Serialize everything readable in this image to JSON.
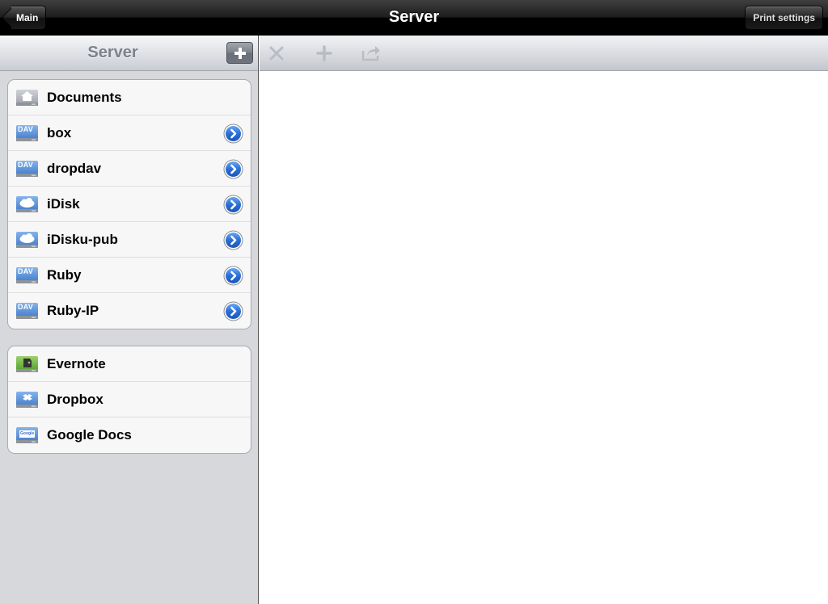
{
  "navbar": {
    "back_label": "Main",
    "title": "Server",
    "print_label": "Print settings"
  },
  "sidebar": {
    "title": "Server",
    "add_icon": "plus-icon",
    "groups": [
      {
        "items": [
          {
            "label": "Documents",
            "icon": "home-drive-icon",
            "disclosure": false
          },
          {
            "label": "box",
            "icon": "dav-drive-icon",
            "disclosure": true
          },
          {
            "label": "dropdav",
            "icon": "dav-drive-icon",
            "disclosure": true
          },
          {
            "label": "iDisk",
            "icon": "cloud-drive-icon",
            "disclosure": true
          },
          {
            "label": "iDisku-pub",
            "icon": "cloud-drive-icon",
            "disclosure": true
          },
          {
            "label": "Ruby",
            "icon": "dav-drive-icon",
            "disclosure": true
          },
          {
            "label": "Ruby-IP",
            "icon": "dav-drive-icon",
            "disclosure": true
          }
        ]
      },
      {
        "items": [
          {
            "label": "Evernote",
            "icon": "evernote-drive-icon",
            "disclosure": false
          },
          {
            "label": "Dropbox",
            "icon": "dropbox-drive-icon",
            "disclosure": false
          },
          {
            "label": "Google Docs",
            "icon": "google-drive-icon",
            "disclosure": false
          }
        ]
      }
    ],
    "dav_text": "DAV",
    "google_text": "Google"
  },
  "toolbar": {
    "tools": [
      "close-icon",
      "plus-icon",
      "share-icon"
    ]
  },
  "colors": {
    "disclosure_blue": "#2a6fd6",
    "sidebar_bg": "#d7d8dc",
    "tool_disabled": "#b9bcc2"
  }
}
